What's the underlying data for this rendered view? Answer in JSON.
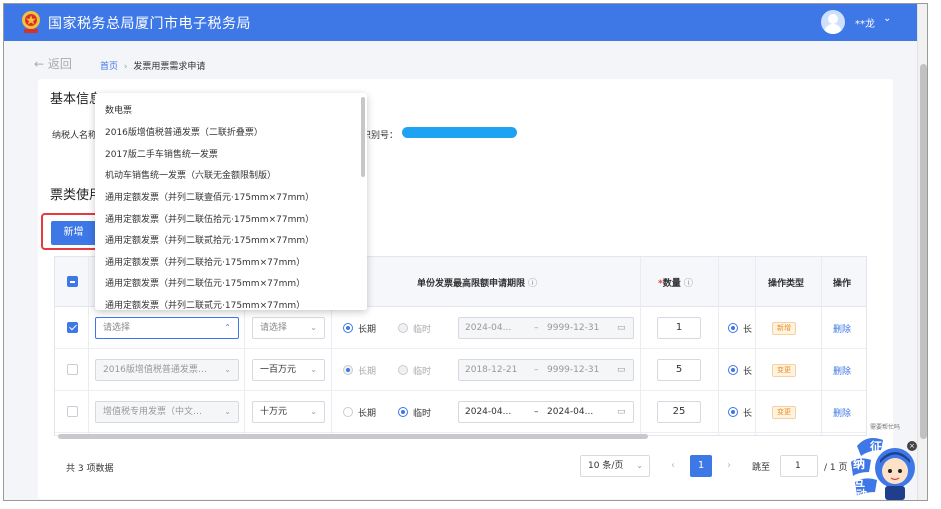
{
  "header": {
    "title": "国家税务总局厦门市电子税务局",
    "user": "**龙"
  },
  "nav": {
    "back": "返回",
    "breadcrumb": {
      "home": "首页",
      "sep": "›",
      "current": "发票用票需求申请"
    }
  },
  "basic_info": {
    "title": "基本信息",
    "taxpayer_label": "纳税人名称：",
    "id_label": "识别号："
  },
  "invoice_section": {
    "title": "票类使用",
    "add_button": "新增"
  },
  "table": {
    "headers": {
      "limit": "单份发票最高限额申请期限",
      "qty_req": "*",
      "qty": "数量",
      "op_type": "操作类型",
      "op": "操作"
    },
    "rows": [
      {
        "checked": true,
        "invoice_type": "请选择",
        "limit": "请选择",
        "period_long": "长期",
        "period_temp": "临时",
        "period_selected": "long",
        "date_from": "2024-04...",
        "date_sep": "–",
        "date_to": "9999-12-31",
        "qty": "1",
        "extra": "长",
        "op_type": "新增",
        "op": "删除"
      },
      {
        "checked": false,
        "invoice_type": "2016版增值税普通发票…",
        "limit": "一百万元",
        "period_long": "长期",
        "period_temp": "临时",
        "period_selected": "long",
        "date_from": "2018-12-21",
        "date_sep": "–",
        "date_to": "9999-12-31",
        "qty": "5",
        "extra": "长",
        "op_type": "变更",
        "op": "删除"
      },
      {
        "checked": false,
        "invoice_type": "增值税专用发票（中文…",
        "limit": "十万元",
        "period_long": "长期",
        "period_temp": "临时",
        "period_selected": "temp",
        "date_from": "2024-04...",
        "date_sep": "–",
        "date_to": "2024-04...",
        "qty": "25",
        "extra": "长",
        "op_type": "变更",
        "op": "删除"
      }
    ]
  },
  "dropdown": {
    "options": [
      "数电票",
      "2016版增值税普通发票（二联折叠票）",
      "2017版二手车销售统一发票",
      "机动车销售统一发票（六联无金额限制版）",
      "通用定额发票（并列二联壹佰元·175mm×77mm）",
      "通用定额发票（并列二联伍拾元·175mm×77mm）",
      "通用定额发票（并列二联贰拾元·175mm×77mm）",
      "通用定额发票（并列二联拾元·175mm×77mm）",
      "通用定额发票（并列二联伍元·175mm×77mm）",
      "通用定额发票（并列二联贰元·175mm×77mm）"
    ]
  },
  "pagination": {
    "total": "共 3 项数据",
    "page_size": "10 条/页",
    "prev": "‹",
    "current": "1",
    "next": "›",
    "jump_label": "跳至",
    "jump_value": "1",
    "of": "/ 1 页"
  },
  "mascot": {
    "hint": "需要帮忙吗",
    "chars": [
      "征",
      "纳",
      "互",
      "动"
    ]
  },
  "colors": {
    "primary": "#3e77e6",
    "danger": "#e43c3c",
    "tag": "#e8912c"
  },
  "icons": {
    "back": "arrow-left-icon",
    "info": "info-circle-icon",
    "calendar": "calendar-icon",
    "caret": "chevron-down-icon"
  }
}
